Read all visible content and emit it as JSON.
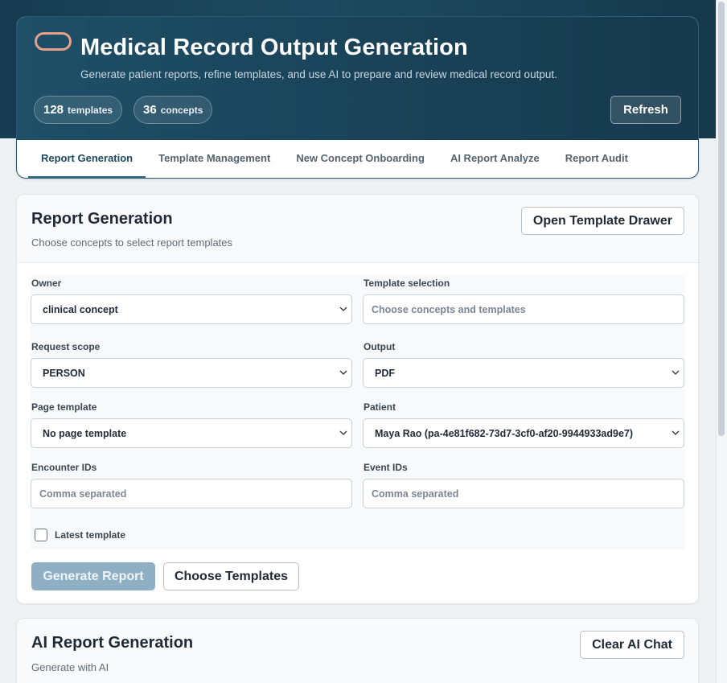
{
  "app": {
    "title": "Medical Record Output Generation",
    "subtitle": "Generate patient reports, refine templates, and use AI to prepare and review medical record output.",
    "stats": [
      {
        "value": "128",
        "label": "templates"
      },
      {
        "value": "36",
        "label": "concepts"
      }
    ],
    "refresh_label": "Refresh"
  },
  "tabs": [
    {
      "label": "Report Generation",
      "active": true
    },
    {
      "label": "Template Management",
      "active": false
    },
    {
      "label": "New Concept Onboarding",
      "active": false
    },
    {
      "label": "AI Report Analyze",
      "active": false
    },
    {
      "label": "Report Audit",
      "active": false
    }
  ],
  "report_generation": {
    "title": "Report Generation",
    "subtitle": "Choose concepts to select report templates",
    "open_drawer_label": "Open Template Drawer",
    "fields": {
      "owner": {
        "label": "Owner",
        "value": "clinical concept"
      },
      "template_selection": {
        "label": "Template selection",
        "placeholder": "Choose concepts and templates"
      },
      "request_scope": {
        "label": "Request scope",
        "value": "PERSON"
      },
      "output": {
        "label": "Output",
        "value": "PDF"
      },
      "page_template": {
        "label": "Page template",
        "value": "No page template"
      },
      "patient": {
        "label": "Patient",
        "value": "Maya Rao (pa-4e81f682-73d7-3cf0-af20-9944933ad9e7)"
      },
      "encounter_ids": {
        "label": "Encounter IDs",
        "placeholder": "Comma separated"
      },
      "event_ids": {
        "label": "Event IDs",
        "placeholder": "Comma separated"
      }
    },
    "latest_template_label": "Latest template",
    "latest_template_checked": false,
    "generate_label": "Generate Report",
    "choose_templates_label": "Choose Templates"
  },
  "ai_report_generation": {
    "title": "AI Report Generation",
    "subtitle": "Generate with AI",
    "clear_label": "Clear AI Chat"
  },
  "colors": {
    "header_dark": "#173c52",
    "accent": "#2e6a86",
    "logo_outline": "#e8a088",
    "primary_disabled": "#8fb0c4"
  }
}
